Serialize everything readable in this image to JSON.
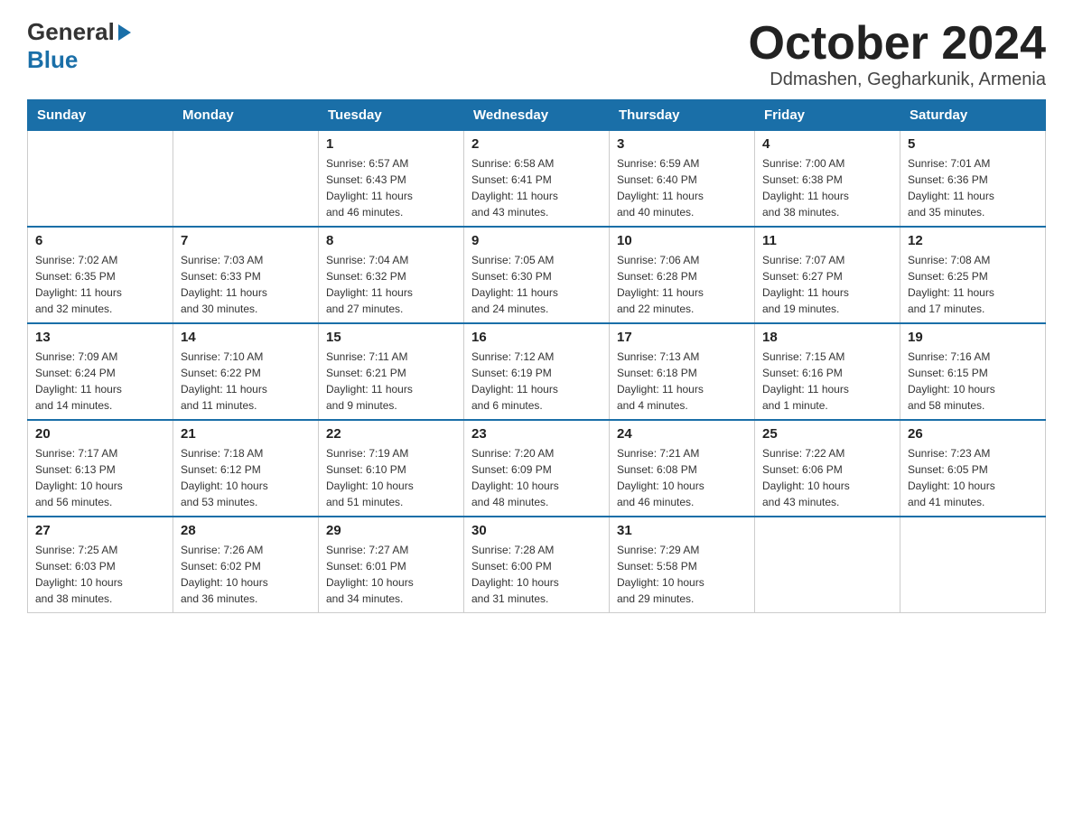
{
  "header": {
    "logo_general": "General",
    "logo_blue": "Blue",
    "title": "October 2024",
    "location": "Ddmashen, Gegharkunik, Armenia"
  },
  "calendar": {
    "days_of_week": [
      "Sunday",
      "Monday",
      "Tuesday",
      "Wednesday",
      "Thursday",
      "Friday",
      "Saturday"
    ],
    "weeks": [
      [
        {
          "day": "",
          "info": ""
        },
        {
          "day": "",
          "info": ""
        },
        {
          "day": "1",
          "info": "Sunrise: 6:57 AM\nSunset: 6:43 PM\nDaylight: 11 hours\nand 46 minutes."
        },
        {
          "day": "2",
          "info": "Sunrise: 6:58 AM\nSunset: 6:41 PM\nDaylight: 11 hours\nand 43 minutes."
        },
        {
          "day": "3",
          "info": "Sunrise: 6:59 AM\nSunset: 6:40 PM\nDaylight: 11 hours\nand 40 minutes."
        },
        {
          "day": "4",
          "info": "Sunrise: 7:00 AM\nSunset: 6:38 PM\nDaylight: 11 hours\nand 38 minutes."
        },
        {
          "day": "5",
          "info": "Sunrise: 7:01 AM\nSunset: 6:36 PM\nDaylight: 11 hours\nand 35 minutes."
        }
      ],
      [
        {
          "day": "6",
          "info": "Sunrise: 7:02 AM\nSunset: 6:35 PM\nDaylight: 11 hours\nand 32 minutes."
        },
        {
          "day": "7",
          "info": "Sunrise: 7:03 AM\nSunset: 6:33 PM\nDaylight: 11 hours\nand 30 minutes."
        },
        {
          "day": "8",
          "info": "Sunrise: 7:04 AM\nSunset: 6:32 PM\nDaylight: 11 hours\nand 27 minutes."
        },
        {
          "day": "9",
          "info": "Sunrise: 7:05 AM\nSunset: 6:30 PM\nDaylight: 11 hours\nand 24 minutes."
        },
        {
          "day": "10",
          "info": "Sunrise: 7:06 AM\nSunset: 6:28 PM\nDaylight: 11 hours\nand 22 minutes."
        },
        {
          "day": "11",
          "info": "Sunrise: 7:07 AM\nSunset: 6:27 PM\nDaylight: 11 hours\nand 19 minutes."
        },
        {
          "day": "12",
          "info": "Sunrise: 7:08 AM\nSunset: 6:25 PM\nDaylight: 11 hours\nand 17 minutes."
        }
      ],
      [
        {
          "day": "13",
          "info": "Sunrise: 7:09 AM\nSunset: 6:24 PM\nDaylight: 11 hours\nand 14 minutes."
        },
        {
          "day": "14",
          "info": "Sunrise: 7:10 AM\nSunset: 6:22 PM\nDaylight: 11 hours\nand 11 minutes."
        },
        {
          "day": "15",
          "info": "Sunrise: 7:11 AM\nSunset: 6:21 PM\nDaylight: 11 hours\nand 9 minutes."
        },
        {
          "day": "16",
          "info": "Sunrise: 7:12 AM\nSunset: 6:19 PM\nDaylight: 11 hours\nand 6 minutes."
        },
        {
          "day": "17",
          "info": "Sunrise: 7:13 AM\nSunset: 6:18 PM\nDaylight: 11 hours\nand 4 minutes."
        },
        {
          "day": "18",
          "info": "Sunrise: 7:15 AM\nSunset: 6:16 PM\nDaylight: 11 hours\nand 1 minute."
        },
        {
          "day": "19",
          "info": "Sunrise: 7:16 AM\nSunset: 6:15 PM\nDaylight: 10 hours\nand 58 minutes."
        }
      ],
      [
        {
          "day": "20",
          "info": "Sunrise: 7:17 AM\nSunset: 6:13 PM\nDaylight: 10 hours\nand 56 minutes."
        },
        {
          "day": "21",
          "info": "Sunrise: 7:18 AM\nSunset: 6:12 PM\nDaylight: 10 hours\nand 53 minutes."
        },
        {
          "day": "22",
          "info": "Sunrise: 7:19 AM\nSunset: 6:10 PM\nDaylight: 10 hours\nand 51 minutes."
        },
        {
          "day": "23",
          "info": "Sunrise: 7:20 AM\nSunset: 6:09 PM\nDaylight: 10 hours\nand 48 minutes."
        },
        {
          "day": "24",
          "info": "Sunrise: 7:21 AM\nSunset: 6:08 PM\nDaylight: 10 hours\nand 46 minutes."
        },
        {
          "day": "25",
          "info": "Sunrise: 7:22 AM\nSunset: 6:06 PM\nDaylight: 10 hours\nand 43 minutes."
        },
        {
          "day": "26",
          "info": "Sunrise: 7:23 AM\nSunset: 6:05 PM\nDaylight: 10 hours\nand 41 minutes."
        }
      ],
      [
        {
          "day": "27",
          "info": "Sunrise: 7:25 AM\nSunset: 6:03 PM\nDaylight: 10 hours\nand 38 minutes."
        },
        {
          "day": "28",
          "info": "Sunrise: 7:26 AM\nSunset: 6:02 PM\nDaylight: 10 hours\nand 36 minutes."
        },
        {
          "day": "29",
          "info": "Sunrise: 7:27 AM\nSunset: 6:01 PM\nDaylight: 10 hours\nand 34 minutes."
        },
        {
          "day": "30",
          "info": "Sunrise: 7:28 AM\nSunset: 6:00 PM\nDaylight: 10 hours\nand 31 minutes."
        },
        {
          "day": "31",
          "info": "Sunrise: 7:29 AM\nSunset: 5:58 PM\nDaylight: 10 hours\nand 29 minutes."
        },
        {
          "day": "",
          "info": ""
        },
        {
          "day": "",
          "info": ""
        }
      ]
    ]
  }
}
